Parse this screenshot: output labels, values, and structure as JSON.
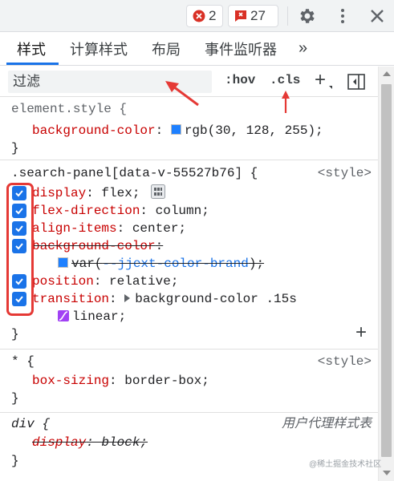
{
  "toolbar": {
    "error_count": "2",
    "warning_count": "27",
    "settings_icon": "gear-icon",
    "more_icon": "kebab-icon",
    "close_icon": "close-icon"
  },
  "tabs": {
    "items": [
      "样式",
      "计算样式",
      "布局",
      "事件监听器"
    ],
    "more_label": "»",
    "active": "样式"
  },
  "filter": {
    "placeholder": "过滤",
    "hov": ":hov",
    "cls": ".cls",
    "add": "+"
  },
  "colors": {
    "accent": "#1a73e8",
    "annotation_red": "#e53935",
    "bg_color_swatch": "#1e80ff"
  },
  "rules": {
    "element_style": {
      "selector": "element.style {",
      "prop": "background-color",
      "value": "rgb(30, 128, 255);",
      "close": "}"
    },
    "search_panel": {
      "selector": ".search-panel[data-v-55527b76] {",
      "source": "<style>",
      "decls": [
        {
          "prop": "display",
          "value": "flex;"
        },
        {
          "prop": "flex-direction",
          "value": "column;"
        },
        {
          "prop": "align-items",
          "value": "center;"
        },
        {
          "prop": "background-color",
          "value": ""
        },
        {
          "prop": "position",
          "value": "relative;"
        },
        {
          "prop": "transition",
          "value": "background-color .15s"
        }
      ],
      "var_prefix": "var(",
      "var_name": "--jjext-color-brand",
      "var_suffix": ");",
      "transition_cont": "linear;",
      "close": "}"
    },
    "universal": {
      "selector": "* {",
      "source": "<style>",
      "prop": "box-sizing",
      "value": "border-box;",
      "close": "}"
    },
    "div_ua": {
      "selector": "div {",
      "source": "用户代理样式表",
      "prop": "display",
      "value": "block;",
      "close": "}"
    }
  },
  "watermark": "@稀土掘金技术社区"
}
